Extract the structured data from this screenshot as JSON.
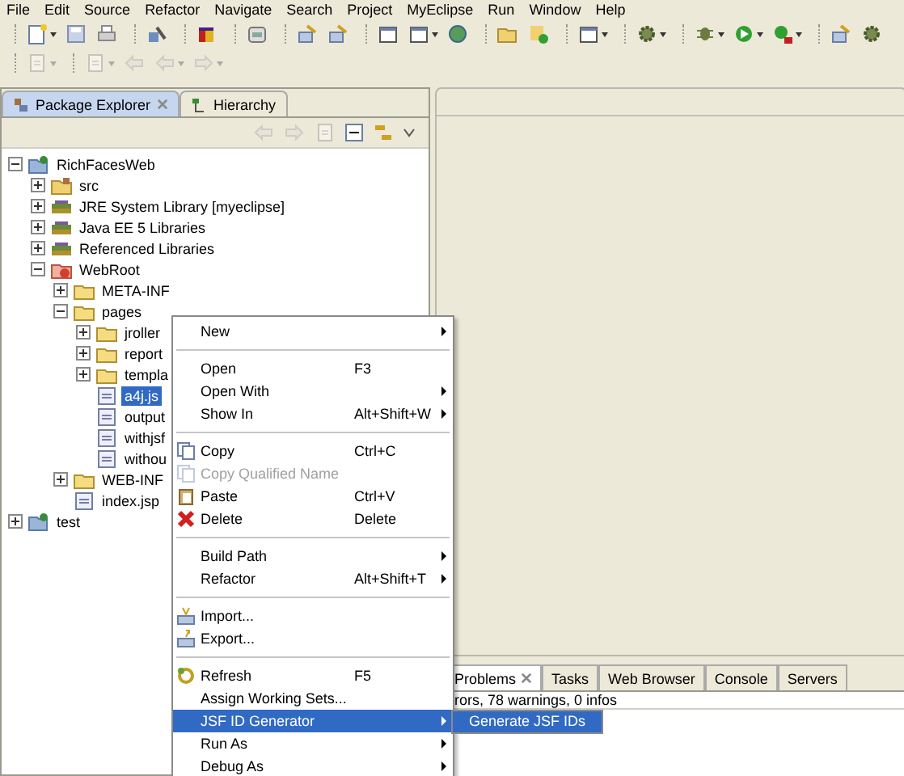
{
  "menu_bar": [
    "File",
    "Edit",
    "Source",
    "Refactor",
    "Navigate",
    "Search",
    "Project",
    "MyEclipse",
    "Run",
    "Window",
    "Help"
  ],
  "explorer": {
    "tabs": [
      {
        "label": "Package Explorer",
        "selected": true
      },
      {
        "label": "Hierarchy",
        "selected": false
      }
    ],
    "tree": [
      {
        "label": "RichFacesWeb",
        "kind": "project",
        "expanded": true,
        "selected": false,
        "children": [
          {
            "label": "src",
            "kind": "source",
            "expanded": false,
            "selected": false
          },
          {
            "label": "JRE System Library [myeclipse]",
            "kind": "library",
            "expanded": false,
            "selected": false
          },
          {
            "label": "Java EE 5 Libraries",
            "kind": "library",
            "expanded": false,
            "selected": false
          },
          {
            "label": "Referenced Libraries",
            "kind": "library",
            "expanded": false,
            "selected": false
          },
          {
            "label": "WebRoot",
            "kind": "webroot",
            "expanded": true,
            "selected": false,
            "children": [
              {
                "label": "META-INF",
                "kind": "folder",
                "expanded": false,
                "selected": false
              },
              {
                "label": "pages",
                "kind": "folder",
                "expanded": true,
                "selected": false,
                "children": [
                  {
                    "label": "jroller",
                    "kind": "folder",
                    "expanded": false,
                    "selected": false
                  },
                  {
                    "label": "report",
                    "kind": "folder",
                    "expanded": false,
                    "selected": false
                  },
                  {
                    "label": "templa",
                    "kind": "folder",
                    "expanded": false,
                    "selected": false
                  },
                  {
                    "label": "a4j.js",
                    "kind": "file",
                    "selected": true
                  },
                  {
                    "label": "output",
                    "kind": "file",
                    "selected": false
                  },
                  {
                    "label": "withjsf",
                    "kind": "file",
                    "selected": false
                  },
                  {
                    "label": "withou",
                    "kind": "file",
                    "selected": false
                  }
                ]
              },
              {
                "label": "WEB-INF",
                "kind": "folder",
                "expanded": false,
                "selected": false
              },
              {
                "label": "index.jsp",
                "kind": "file",
                "selected": false
              }
            ]
          }
        ]
      },
      {
        "label": "test",
        "kind": "project",
        "expanded": false,
        "selected": false
      }
    ]
  },
  "bottom_panel": {
    "tabs": [
      {
        "label": "Problems",
        "selected": true
      },
      {
        "label": "Tasks",
        "selected": false
      },
      {
        "label": "Web Browser",
        "selected": false
      },
      {
        "label": "Console",
        "selected": false
      },
      {
        "label": "Servers",
        "selected": false
      }
    ],
    "summary": "rors, 78 warnings, 0 infos"
  },
  "context_menu": [
    {
      "kind": "item",
      "label": "New",
      "submenu": true,
      "disabled": false,
      "selected": false
    },
    {
      "kind": "separator"
    },
    {
      "kind": "item",
      "label": "Open",
      "shortcut": "F3",
      "submenu": false,
      "disabled": false,
      "selected": false
    },
    {
      "kind": "item",
      "label": "Open With",
      "submenu": true,
      "disabled": false,
      "selected": false
    },
    {
      "kind": "item",
      "label": "Show In",
      "shortcut": "Alt+Shift+W",
      "submenu": true,
      "disabled": false,
      "selected": false
    },
    {
      "kind": "separator"
    },
    {
      "kind": "item",
      "label": "Copy",
      "shortcut": "Ctrl+C",
      "submenu": false,
      "disabled": false,
      "selected": false
    },
    {
      "kind": "item",
      "label": "Copy Qualified Name",
      "submenu": false,
      "disabled": true,
      "selected": false
    },
    {
      "kind": "item",
      "label": "Paste",
      "shortcut": "Ctrl+V",
      "submenu": false,
      "disabled": false,
      "selected": false
    },
    {
      "kind": "item",
      "label": "Delete",
      "shortcut": "Delete",
      "submenu": false,
      "disabled": false,
      "selected": false
    },
    {
      "kind": "separator"
    },
    {
      "kind": "item",
      "label": "Build Path",
      "submenu": true,
      "disabled": false,
      "selected": false
    },
    {
      "kind": "item",
      "label": "Refactor",
      "shortcut": "Alt+Shift+T",
      "submenu": true,
      "disabled": false,
      "selected": false
    },
    {
      "kind": "separator"
    },
    {
      "kind": "item",
      "label": "Import...",
      "submenu": false,
      "disabled": false,
      "selected": false
    },
    {
      "kind": "item",
      "label": "Export...",
      "submenu": false,
      "disabled": false,
      "selected": false
    },
    {
      "kind": "separator"
    },
    {
      "kind": "item",
      "label": "Refresh",
      "shortcut": "F5",
      "submenu": false,
      "disabled": false,
      "selected": false
    },
    {
      "kind": "item",
      "label": "Assign Working Sets...",
      "submenu": false,
      "disabled": false,
      "selected": false
    },
    {
      "kind": "item",
      "label": "JSF ID Generator",
      "submenu": true,
      "disabled": false,
      "selected": true
    },
    {
      "kind": "item",
      "label": "Run As",
      "submenu": true,
      "disabled": false,
      "selected": false
    },
    {
      "kind": "item",
      "label": "Debug As",
      "submenu": true,
      "disabled": false,
      "selected": false
    }
  ],
  "submenu": [
    {
      "label": "Generate JSF IDs",
      "selected": true
    }
  ]
}
